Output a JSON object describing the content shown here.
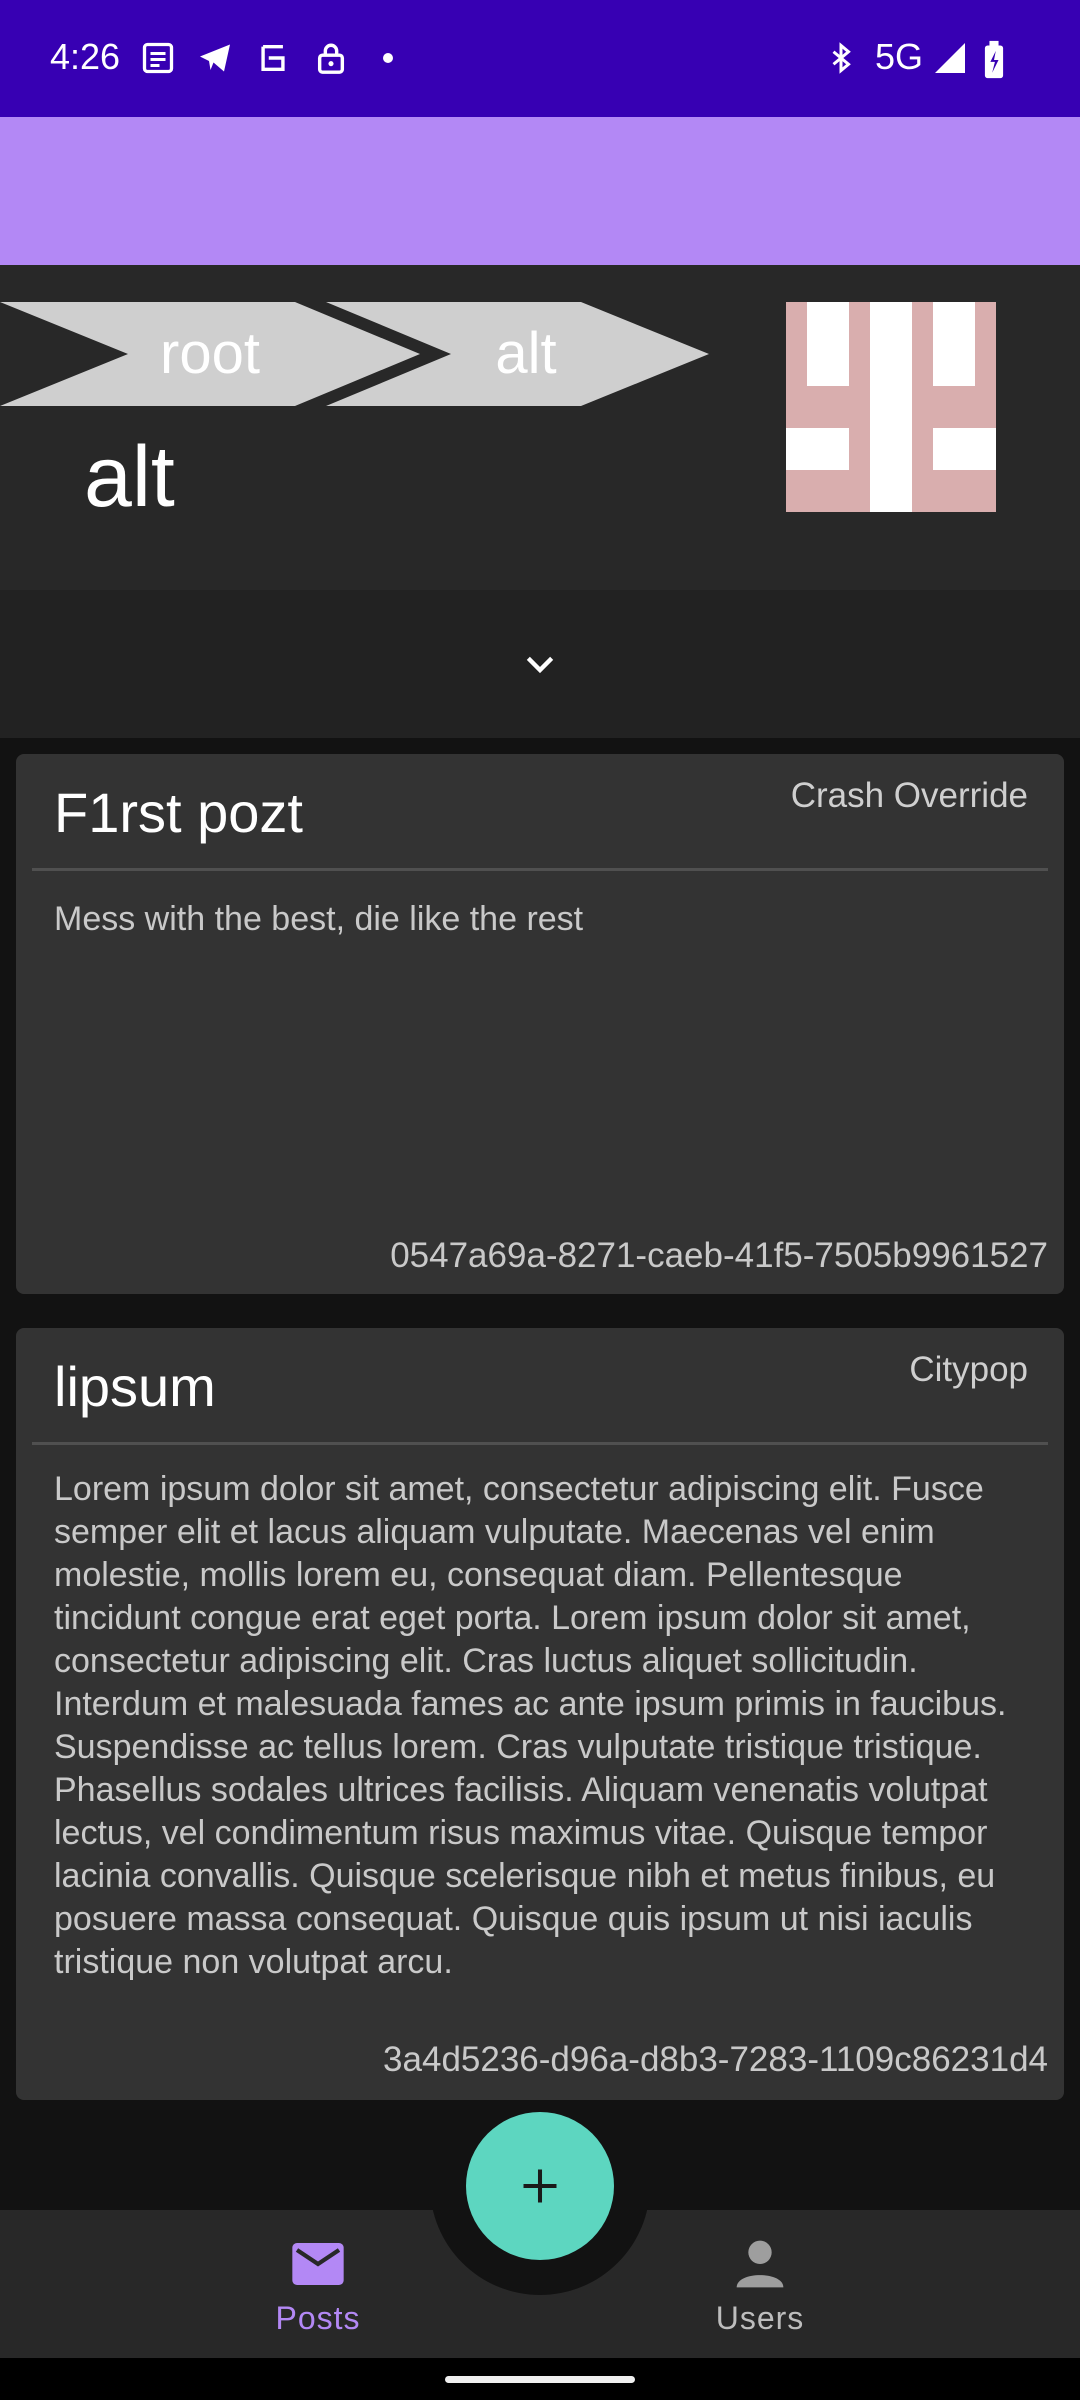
{
  "status_bar": {
    "time": "4:26",
    "network": "5G",
    "icons": [
      "news-icon",
      "telegram-icon",
      "vpn-icon",
      "lock-icon",
      "dot-icon",
      "bluetooth-icon",
      "signal-icon",
      "battery-charging-icon"
    ]
  },
  "breadcrumbs": [
    {
      "label": "root"
    },
    {
      "label": "alt"
    }
  ],
  "header": {
    "title": "alt",
    "identicon_color": "#d9aeae"
  },
  "expander": {
    "icon": "chevron-down-icon"
  },
  "posts": [
    {
      "title": "F1rst pozt",
      "author": "Crash Override",
      "body": "Mess with the best, die like the rest",
      "id": "0547a69a-8271-caeb-41f5-7505b9961527"
    },
    {
      "title": "lipsum",
      "author": "Citypop",
      "body": "Lorem ipsum dolor sit amet, consectetur adipiscing elit. Fusce semper elit et lacus aliquam vulputate. Maecenas vel enim molestie, mollis lorem eu, consequat diam. Pellentesque tincidunt congue erat eget porta. Lorem ipsum dolor sit amet, consectetur adipiscing elit. Cras luctus aliquet sollicitudin. Interdum et malesuada fames ac ante ipsum primis in faucibus. Suspendisse ac tellus lorem. Cras vulputate tristique tristique. Phasellus sodales ultrices facilisis. Aliquam venenatis volutpat lectus, vel condimentum risus maximus vitae. Quisque tempor lacinia convallis. Quisque scelerisque nibh et metus finibus, eu posuere massa consequat. Quisque quis ipsum ut nisi iaculis tristique non volutpat arcu.",
      "id": "3a4d5236-d96a-d8b3-7283-1109c86231d4"
    }
  ],
  "fab": {
    "icon": "plus-icon"
  },
  "bottom_nav": {
    "items": [
      {
        "label": "Posts",
        "icon": "mail-icon",
        "selected": true
      },
      {
        "label": "Users",
        "icon": "person-icon",
        "selected": false
      }
    ]
  },
  "colors": {
    "status_bar": "#3700b3",
    "toolbar": "#b388f5",
    "accent": "#5dd6c0",
    "nav_selected": "#b388f5",
    "nav_unselected": "#bdbdbd"
  }
}
